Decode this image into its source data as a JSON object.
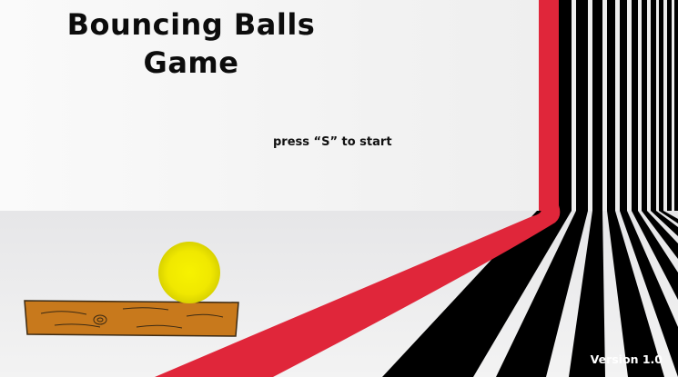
{
  "game": {
    "title_line1": "Bouncing Balls",
    "title_line2": "Game",
    "start_hint": "press “S” to start",
    "version": "Version 1.0"
  },
  "colors": {
    "background": "#f4f4f4",
    "stripe_red": "#e0263a",
    "stripe_black": "#000000",
    "ball_yellow": "#f2ec00",
    "plank_brown": "#c8791c"
  },
  "objects": {
    "ball": "yellow-ball",
    "platform": "wooden-plank"
  }
}
